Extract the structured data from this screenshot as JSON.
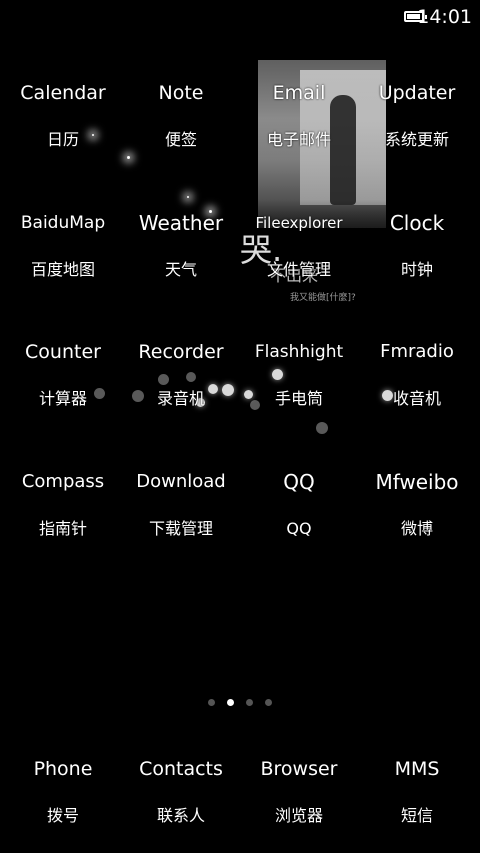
{
  "status_bar": {
    "time": "14:01",
    "battery_icon": "battery-icon"
  },
  "wallpaper": {
    "caption_main": "哭.",
    "caption_sub": "不出来",
    "caption_small": "我又能做[什麼]?"
  },
  "apps": [
    {
      "icon_label": "Calendar",
      "name": "日历"
    },
    {
      "icon_label": "Note",
      "name": "便签"
    },
    {
      "icon_label": "Email",
      "name": "电子邮件"
    },
    {
      "icon_label": "Updater",
      "name": "系统更新"
    },
    {
      "icon_label": "BaiduMap",
      "name": "百度地图"
    },
    {
      "icon_label": "Weather",
      "name": "天气"
    },
    {
      "icon_label": "Fileexplorer",
      "name": "文件管理"
    },
    {
      "icon_label": "Clock",
      "name": "时钟"
    },
    {
      "icon_label": "Counter",
      "name": "计算器"
    },
    {
      "icon_label": "Recorder",
      "name": "录音机"
    },
    {
      "icon_label": "Flashhight",
      "name": "手电筒"
    },
    {
      "icon_label": "Fmradio",
      "name": "收音机"
    },
    {
      "icon_label": "Compass",
      "name": "指南针"
    },
    {
      "icon_label": "Download",
      "name": "下载管理"
    },
    {
      "icon_label": "QQ",
      "name": "QQ"
    },
    {
      "icon_label": "Mfweibo",
      "name": "微博"
    }
  ],
  "page_indicator": {
    "total_pages": 4,
    "active_page": 2
  },
  "dock": [
    {
      "icon_label": "Phone",
      "name": "拨号"
    },
    {
      "icon_label": "Contacts",
      "name": "联系人"
    },
    {
      "icon_label": "Browser",
      "name": "浏览器"
    },
    {
      "icon_label": "MMS",
      "name": "短信"
    }
  ]
}
